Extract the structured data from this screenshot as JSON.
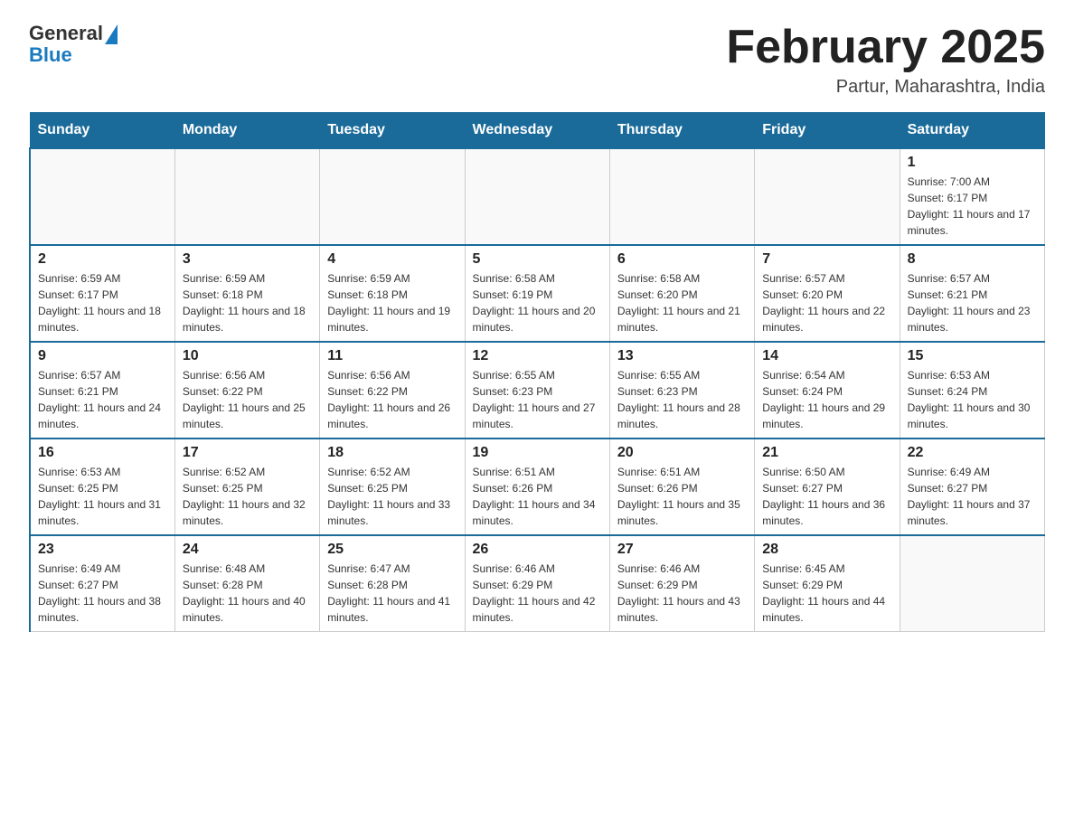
{
  "header": {
    "logo_general": "General",
    "logo_blue": "Blue",
    "title": "February 2025",
    "subtitle": "Partur, Maharashtra, India"
  },
  "weekdays": [
    "Sunday",
    "Monday",
    "Tuesday",
    "Wednesday",
    "Thursday",
    "Friday",
    "Saturday"
  ],
  "weeks": [
    [
      {
        "day": "",
        "info": ""
      },
      {
        "day": "",
        "info": ""
      },
      {
        "day": "",
        "info": ""
      },
      {
        "day": "",
        "info": ""
      },
      {
        "day": "",
        "info": ""
      },
      {
        "day": "",
        "info": ""
      },
      {
        "day": "1",
        "info": "Sunrise: 7:00 AM\nSunset: 6:17 PM\nDaylight: 11 hours and 17 minutes."
      }
    ],
    [
      {
        "day": "2",
        "info": "Sunrise: 6:59 AM\nSunset: 6:17 PM\nDaylight: 11 hours and 18 minutes."
      },
      {
        "day": "3",
        "info": "Sunrise: 6:59 AM\nSunset: 6:18 PM\nDaylight: 11 hours and 18 minutes."
      },
      {
        "day": "4",
        "info": "Sunrise: 6:59 AM\nSunset: 6:18 PM\nDaylight: 11 hours and 19 minutes."
      },
      {
        "day": "5",
        "info": "Sunrise: 6:58 AM\nSunset: 6:19 PM\nDaylight: 11 hours and 20 minutes."
      },
      {
        "day": "6",
        "info": "Sunrise: 6:58 AM\nSunset: 6:20 PM\nDaylight: 11 hours and 21 minutes."
      },
      {
        "day": "7",
        "info": "Sunrise: 6:57 AM\nSunset: 6:20 PM\nDaylight: 11 hours and 22 minutes."
      },
      {
        "day": "8",
        "info": "Sunrise: 6:57 AM\nSunset: 6:21 PM\nDaylight: 11 hours and 23 minutes."
      }
    ],
    [
      {
        "day": "9",
        "info": "Sunrise: 6:57 AM\nSunset: 6:21 PM\nDaylight: 11 hours and 24 minutes."
      },
      {
        "day": "10",
        "info": "Sunrise: 6:56 AM\nSunset: 6:22 PM\nDaylight: 11 hours and 25 minutes."
      },
      {
        "day": "11",
        "info": "Sunrise: 6:56 AM\nSunset: 6:22 PM\nDaylight: 11 hours and 26 minutes."
      },
      {
        "day": "12",
        "info": "Sunrise: 6:55 AM\nSunset: 6:23 PM\nDaylight: 11 hours and 27 minutes."
      },
      {
        "day": "13",
        "info": "Sunrise: 6:55 AM\nSunset: 6:23 PM\nDaylight: 11 hours and 28 minutes."
      },
      {
        "day": "14",
        "info": "Sunrise: 6:54 AM\nSunset: 6:24 PM\nDaylight: 11 hours and 29 minutes."
      },
      {
        "day": "15",
        "info": "Sunrise: 6:53 AM\nSunset: 6:24 PM\nDaylight: 11 hours and 30 minutes."
      }
    ],
    [
      {
        "day": "16",
        "info": "Sunrise: 6:53 AM\nSunset: 6:25 PM\nDaylight: 11 hours and 31 minutes."
      },
      {
        "day": "17",
        "info": "Sunrise: 6:52 AM\nSunset: 6:25 PM\nDaylight: 11 hours and 32 minutes."
      },
      {
        "day": "18",
        "info": "Sunrise: 6:52 AM\nSunset: 6:25 PM\nDaylight: 11 hours and 33 minutes."
      },
      {
        "day": "19",
        "info": "Sunrise: 6:51 AM\nSunset: 6:26 PM\nDaylight: 11 hours and 34 minutes."
      },
      {
        "day": "20",
        "info": "Sunrise: 6:51 AM\nSunset: 6:26 PM\nDaylight: 11 hours and 35 minutes."
      },
      {
        "day": "21",
        "info": "Sunrise: 6:50 AM\nSunset: 6:27 PM\nDaylight: 11 hours and 36 minutes."
      },
      {
        "day": "22",
        "info": "Sunrise: 6:49 AM\nSunset: 6:27 PM\nDaylight: 11 hours and 37 minutes."
      }
    ],
    [
      {
        "day": "23",
        "info": "Sunrise: 6:49 AM\nSunset: 6:27 PM\nDaylight: 11 hours and 38 minutes."
      },
      {
        "day": "24",
        "info": "Sunrise: 6:48 AM\nSunset: 6:28 PM\nDaylight: 11 hours and 40 minutes."
      },
      {
        "day": "25",
        "info": "Sunrise: 6:47 AM\nSunset: 6:28 PM\nDaylight: 11 hours and 41 minutes."
      },
      {
        "day": "26",
        "info": "Sunrise: 6:46 AM\nSunset: 6:29 PM\nDaylight: 11 hours and 42 minutes."
      },
      {
        "day": "27",
        "info": "Sunrise: 6:46 AM\nSunset: 6:29 PM\nDaylight: 11 hours and 43 minutes."
      },
      {
        "day": "28",
        "info": "Sunrise: 6:45 AM\nSunset: 6:29 PM\nDaylight: 11 hours and 44 minutes."
      },
      {
        "day": "",
        "info": ""
      }
    ]
  ]
}
